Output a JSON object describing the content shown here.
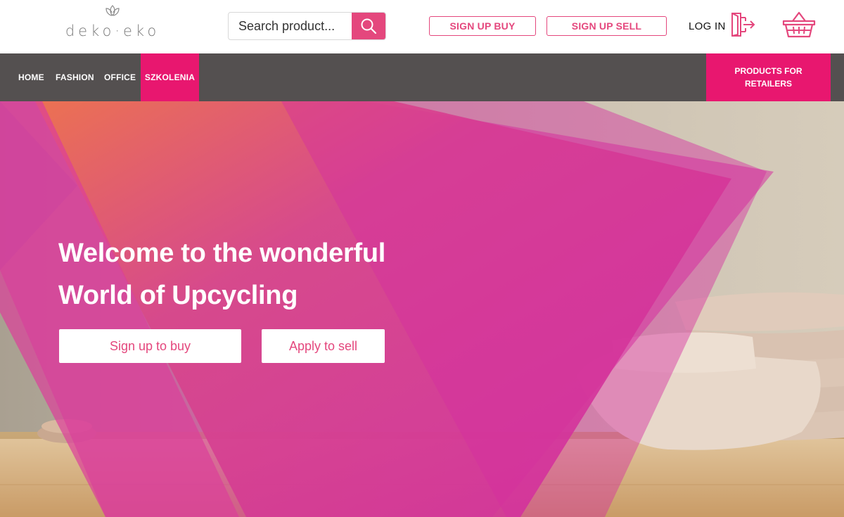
{
  "brand": {
    "logo_text": "deko·eko"
  },
  "header": {
    "search_placeholder": "Search product...",
    "sign_up_buy": "SIGN UP BUY",
    "sign_up_sell": "SIGN UP SELL",
    "log_in": "LOG IN",
    "icons": [
      "search-icon",
      "login-door-icon",
      "shopping-basket-icon"
    ]
  },
  "nav": {
    "items": [
      "HOME",
      "FASHION",
      "OFFICE",
      "SZKOLENIA"
    ],
    "active": "SZKOLENIA",
    "retailers": "PRODUCTS FOR RETAILERS"
  },
  "hero": {
    "title_line1": "Welcome to the wonderful",
    "title_line2": "World of Upcycling",
    "btn_buy": "Sign up to buy",
    "btn_sell": "Apply to sell"
  },
  "colors": {
    "accent": "#e4477d",
    "nav_active": "#e8176f",
    "nav_bg": "#545050",
    "overlay_pink": "#d8329b",
    "overlay_orange": "#f0734a"
  }
}
